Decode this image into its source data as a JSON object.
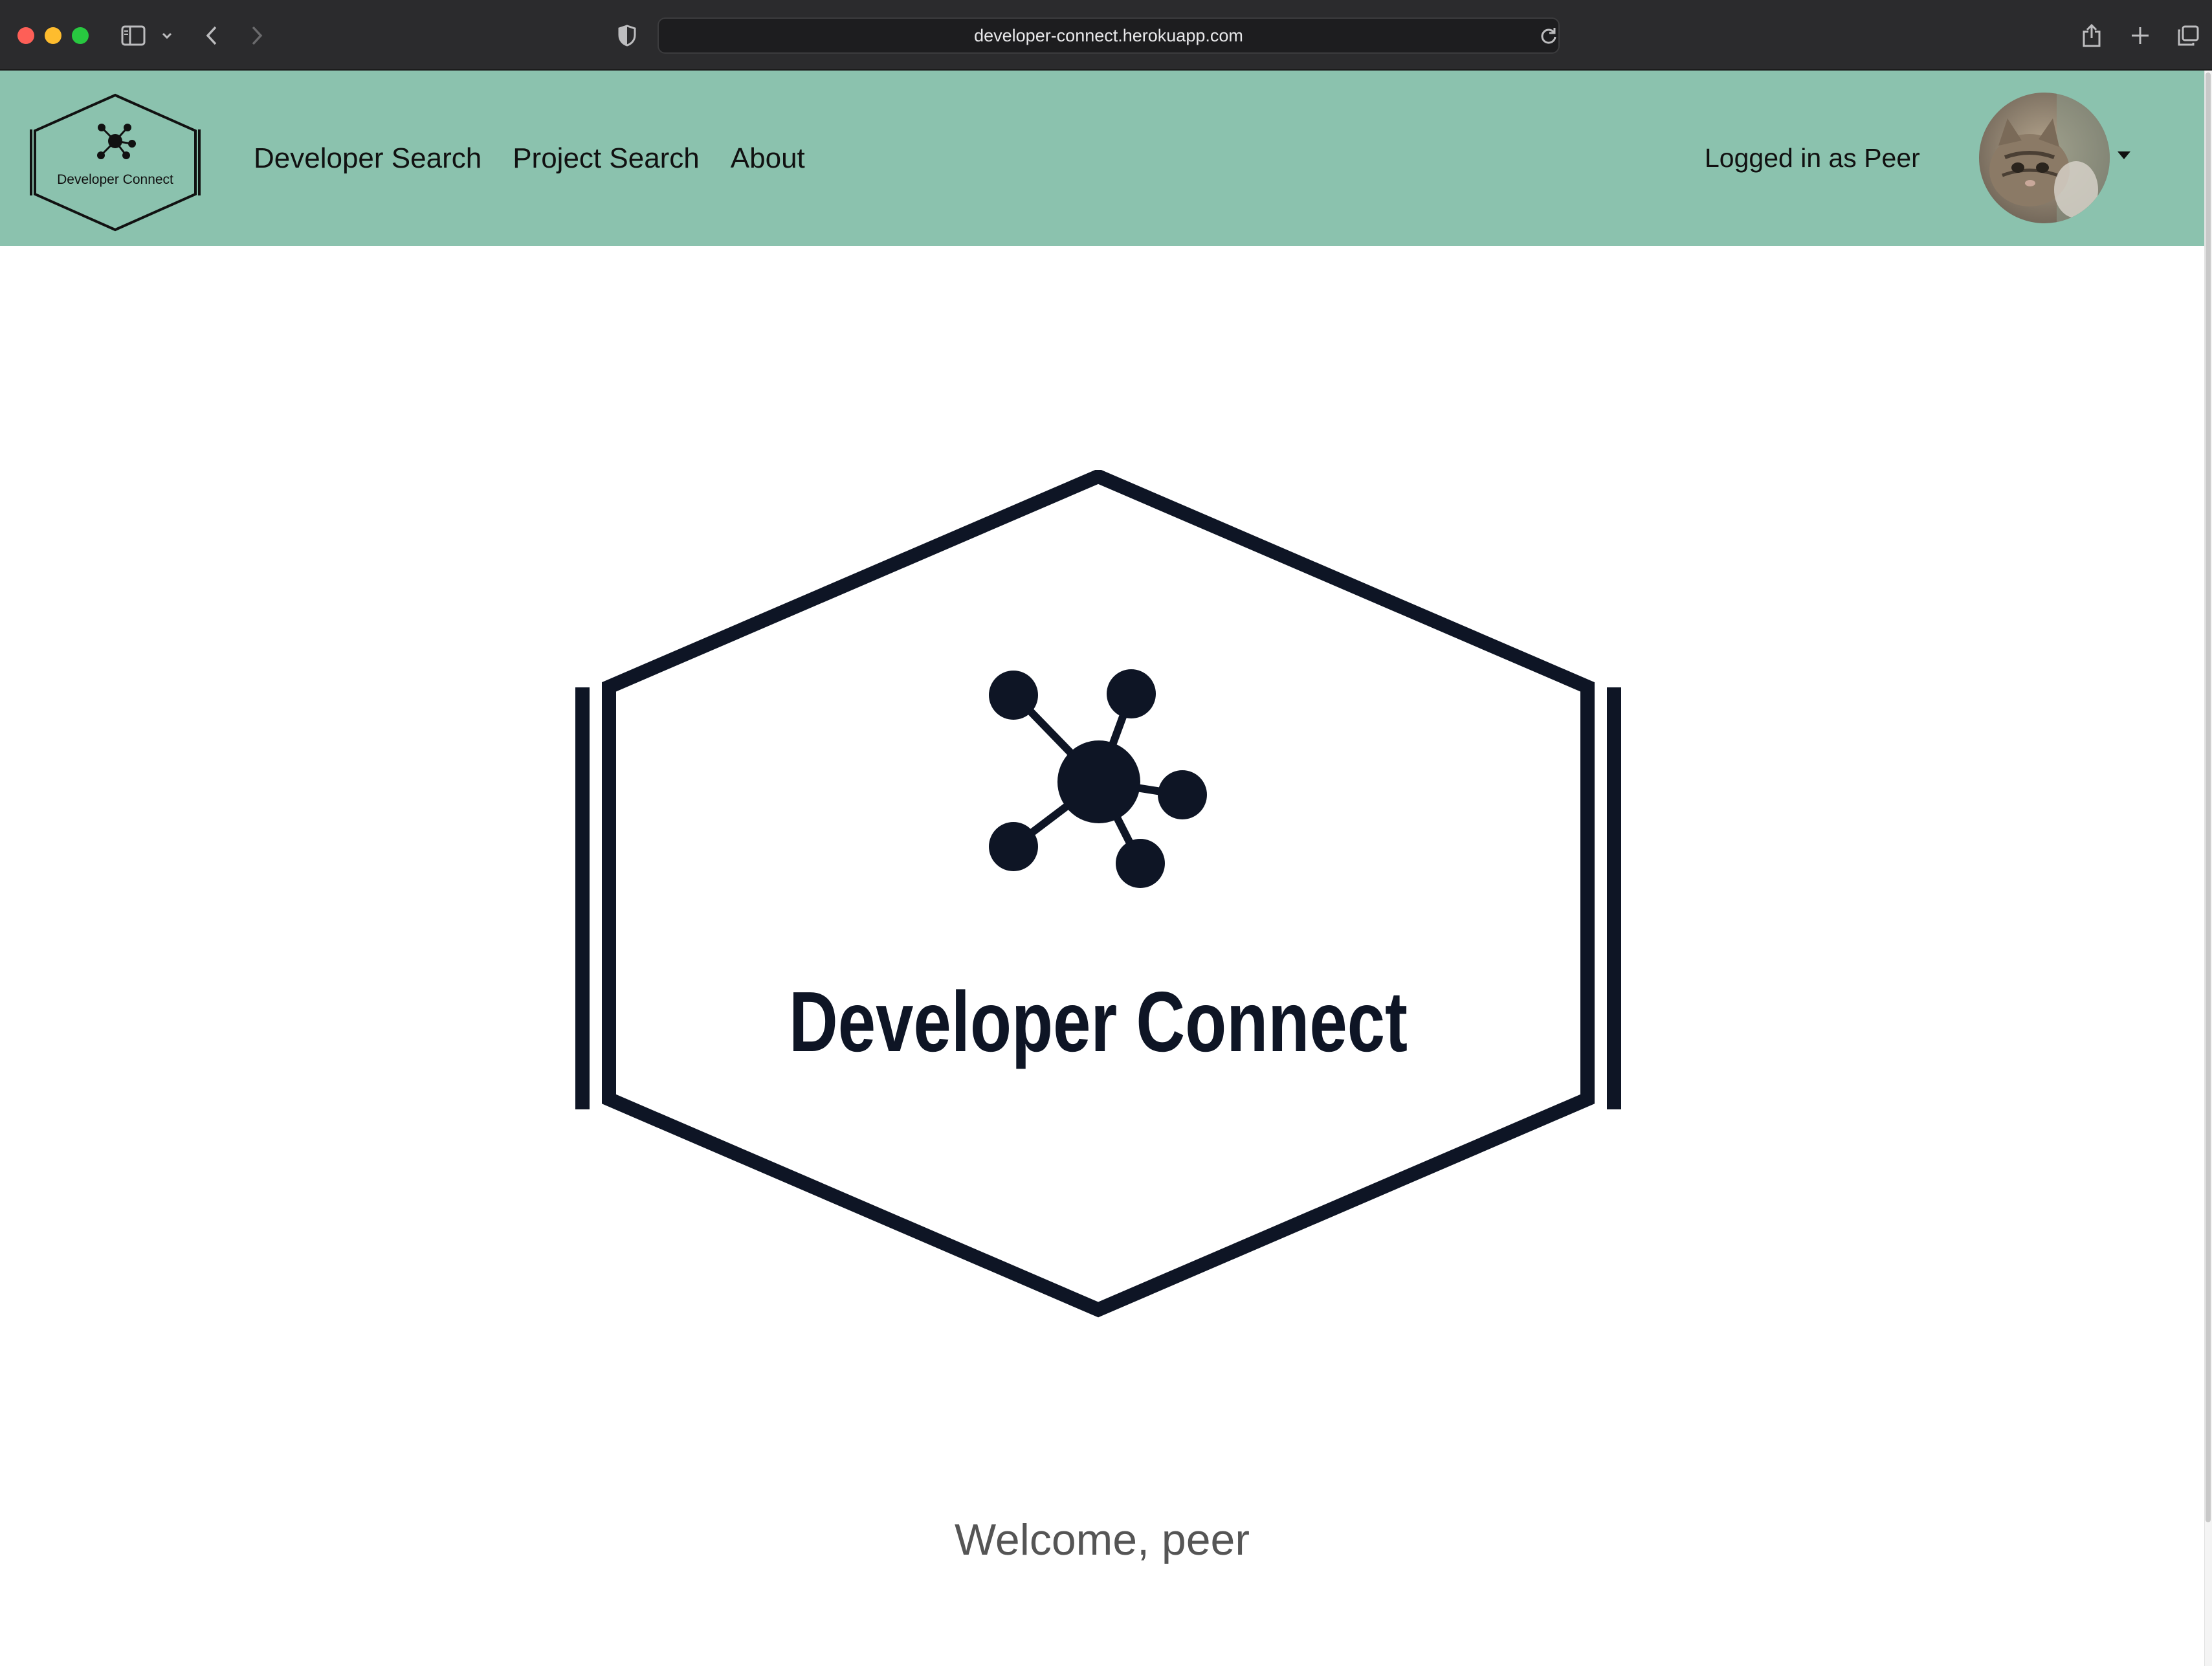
{
  "browser": {
    "url": "developer-connect.herokuapp.com",
    "icons": {
      "sidebar": "sidebar-icon",
      "sidebar_menu": "chevron-down-icon",
      "back": "back-arrow-icon",
      "forward": "forward-arrow-icon",
      "privacy": "shield-icon",
      "reload": "reload-icon",
      "share": "share-icon",
      "new_tab": "plus-icon",
      "tabs": "tab-overview-icon"
    }
  },
  "navbar": {
    "background": "#8bc2ae",
    "logo_text": "Developer Connect",
    "links": [
      "Developer Search",
      "Project Search",
      "About"
    ],
    "logged_in_text": "Logged in as Peer"
  },
  "main": {
    "logo_text": "Developer Connect",
    "welcome": "Welcome, peer"
  }
}
